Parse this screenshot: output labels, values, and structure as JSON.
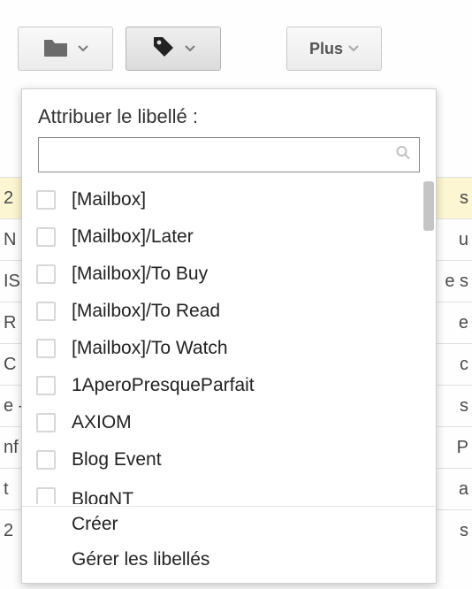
{
  "toolbar": {
    "move_to": "Déplacer vers",
    "labels": "Libellés",
    "more": "Plus"
  },
  "dropdown": {
    "title": "Attribuer le libellé :",
    "search_value": "",
    "labels": [
      "[Mailbox]",
      "[Mailbox]/Later",
      "[Mailbox]/To Buy",
      "[Mailbox]/To Read",
      "[Mailbox]/To Watch",
      "1AperoPresqueParfait",
      "AXIOM",
      "Blog Event",
      "BlogNT"
    ],
    "create": "Créer",
    "manage": "Gérer les libellés"
  },
  "background_rows": [
    {
      "left": "2",
      "right": "s",
      "highlight": true
    },
    {
      "left": "N",
      "right": "u"
    },
    {
      "left": "IS",
      "right": "e s"
    },
    {
      "left": "R",
      "right": "e"
    },
    {
      "left": "C",
      "right": "c"
    },
    {
      "left": "e -",
      "right": "s"
    },
    {
      "left": "nf",
      "right": "P"
    },
    {
      "left": "t",
      "right": "a"
    },
    {
      "left": "2",
      "right": "s"
    }
  ]
}
